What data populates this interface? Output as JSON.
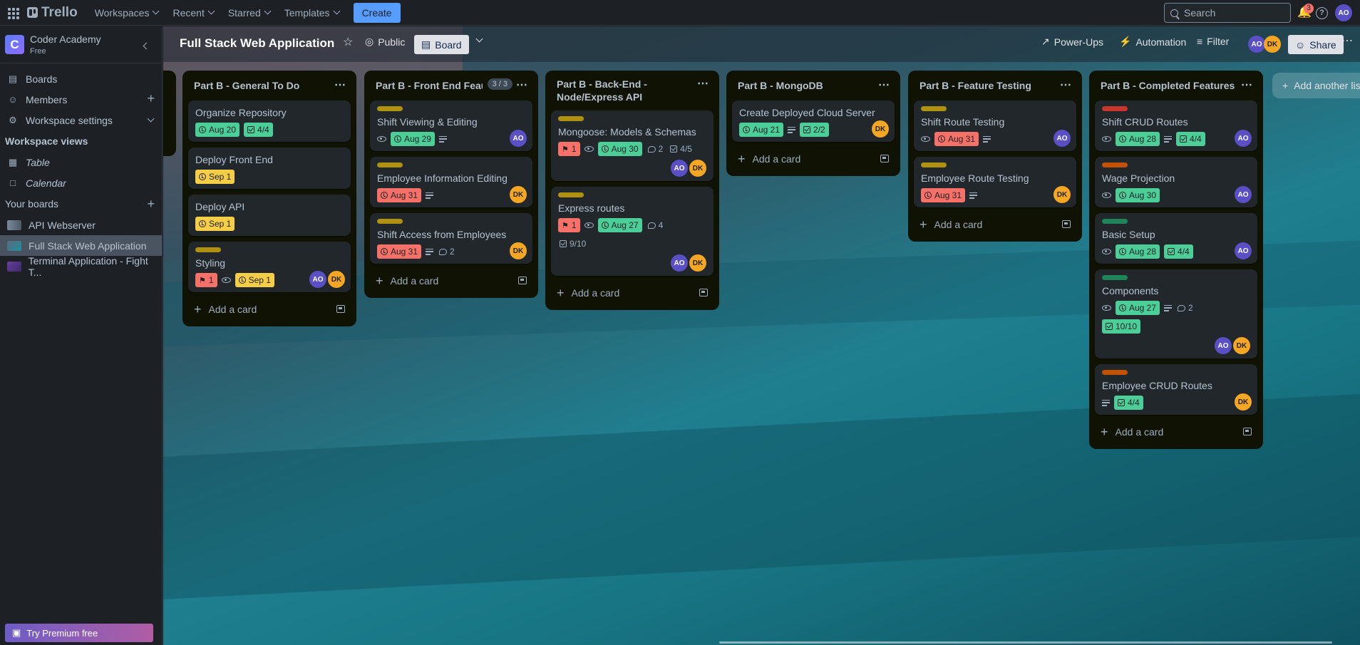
{
  "nav": {
    "logo": "Trello",
    "items": [
      {
        "label": "Workspaces"
      },
      {
        "label": "Recent"
      },
      {
        "label": "Starred"
      },
      {
        "label": "Templates"
      }
    ],
    "create_label": "Create",
    "search_placeholder": "Search",
    "notifications_count": "3",
    "user_initials": "AO"
  },
  "sidebar": {
    "workspace_initial": "C",
    "workspace_name": "Coder Academy",
    "workspace_plan": "Free",
    "items": [
      {
        "label": "Boards"
      },
      {
        "label": "Members"
      },
      {
        "label": "Workspace settings"
      }
    ],
    "views_title": "Workspace views",
    "views": [
      {
        "label": "Table"
      },
      {
        "label": "Calendar"
      }
    ],
    "your_boards_title": "Your boards",
    "boards": [
      {
        "label": "API Webserver"
      },
      {
        "label": "Full Stack Web Application"
      },
      {
        "label": "Terminal Application - Fight T..."
      }
    ],
    "premium_label": "Try Premium free"
  },
  "board": {
    "title": "Full Stack Web Application",
    "visibility": "Public",
    "view_label": "Board",
    "powerups_label": "Power-Ups",
    "automation_label": "Automation",
    "filter_label": "Filter",
    "share_label": "Share",
    "members": [
      "AO",
      "DK"
    ],
    "add_list_label": "Add another list",
    "add_card_label": "Add a card"
  },
  "lists": [
    {
      "title": "Part B - General To Do",
      "cards": [
        {
          "title": "Organize Repository",
          "due": "Aug 20",
          "checklist": "4/4"
        },
        {
          "title": "Deploy Front End",
          "due": "Sep 1"
        },
        {
          "title": "Deploy API",
          "due": "Sep 1"
        },
        {
          "title": "Styling",
          "attachments": "1",
          "due": "Sep 1",
          "members": [
            "AO",
            "DK"
          ]
        }
      ]
    },
    {
      "title": "Part B - Front End Feautures",
      "count": "3 / 3",
      "cards": [
        {
          "title": "Shift Viewing & Editing",
          "due": "Aug 29",
          "members": [
            "AO"
          ]
        },
        {
          "title": "Employee Information Editing",
          "due": "Aug 31",
          "members": [
            "DK"
          ]
        },
        {
          "title": "Shift Access from Employees",
          "due": "Aug 31",
          "comments": "2",
          "members": [
            "DK"
          ]
        }
      ]
    },
    {
      "title": "Part B - Back-End - Node/Express API",
      "title_line1": "Part B - Back-End -",
      "title_line2": "Node/Express API",
      "cards": [
        {
          "title": "Mongoose: Models & Schemas",
          "attachments": "1",
          "due": "Aug 30",
          "comments": "2",
          "checklist": "4/5",
          "members": [
            "AO",
            "DK"
          ]
        },
        {
          "title": "Express routes",
          "attachments": "1",
          "due": "Aug 27",
          "comments": "4",
          "checklist": "9/10",
          "members": [
            "AO",
            "DK"
          ]
        }
      ]
    },
    {
      "title": "Part B - MongoDB",
      "cards": [
        {
          "title": "Create Deployed Cloud Server",
          "due": "Aug 21",
          "checklist": "2/2",
          "members": [
            "DK"
          ]
        }
      ]
    },
    {
      "title": "Part B - Feature Testing",
      "cards": [
        {
          "title": "Shift Route Testing",
          "due": "Aug 31",
          "members": [
            "AO"
          ]
        },
        {
          "title": "Employee Route Testing",
          "due": "Aug 31",
          "members": [
            "DK"
          ]
        }
      ]
    },
    {
      "title": "Part B - Completed Features",
      "cards": [
        {
          "title": "Shift CRUD Routes",
          "due": "Aug 28",
          "checklist": "4/4",
          "members": [
            "AO"
          ]
        },
        {
          "title": "Wage Projection",
          "due": "Aug 30",
          "members": [
            "AO"
          ]
        },
        {
          "title": "Basic Setup",
          "due": "Aug 28",
          "checklist": "4/4",
          "members": [
            "AO"
          ]
        },
        {
          "title": "Components",
          "due": "Aug 27",
          "comments": "2",
          "checklist": "10/10",
          "members": [
            "AO",
            "DK"
          ]
        },
        {
          "title": "Employee CRUD Routes",
          "checklist": "4/4",
          "members": [
            "DK"
          ]
        }
      ]
    }
  ],
  "colors": {
    "label_yellow": "#b0900f",
    "label_red": "#c9372c",
    "label_orange": "#c25100",
    "label_green": "#1f845a",
    "due_complete": "#4bce97",
    "due_overdue": "#f87168",
    "due_soon": "#f5cd47",
    "accent": "#579dff"
  }
}
